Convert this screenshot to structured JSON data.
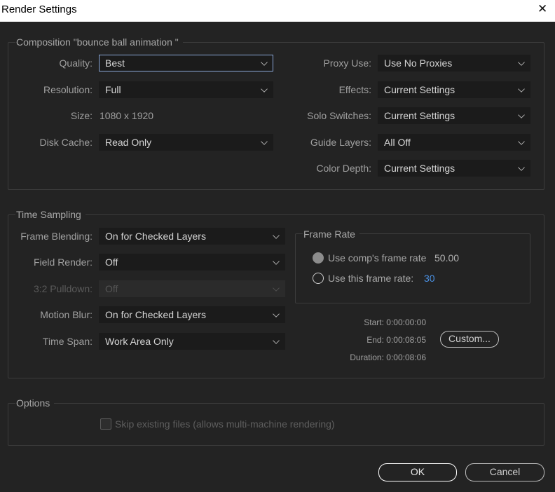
{
  "window": {
    "title": "Render Settings",
    "close_glyph": "✕"
  },
  "composition": {
    "legend": "Composition \"bounce ball animation \"",
    "quality": {
      "label": "Quality:",
      "value": "Best"
    },
    "resolution": {
      "label": "Resolution:",
      "value": "Full"
    },
    "size": {
      "label": "Size:",
      "value": "1080 x 1920"
    },
    "disk_cache": {
      "label": "Disk Cache:",
      "value": "Read Only"
    },
    "proxy_use": {
      "label": "Proxy Use:",
      "value": "Use No Proxies"
    },
    "effects": {
      "label": "Effects:",
      "value": "Current Settings"
    },
    "solo_switches": {
      "label": "Solo Switches:",
      "value": "Current Settings"
    },
    "guide_layers": {
      "label": "Guide Layers:",
      "value": "All Off"
    },
    "color_depth": {
      "label": "Color Depth:",
      "value": "Current Settings"
    }
  },
  "time_sampling": {
    "legend": "Time Sampling",
    "frame_blending": {
      "label": "Frame Blending:",
      "value": "On for Checked Layers"
    },
    "field_render": {
      "label": "Field Render:",
      "value": "Off"
    },
    "pulldown": {
      "label": "3:2 Pulldown:",
      "value": "Off"
    },
    "motion_blur": {
      "label": "Motion Blur:",
      "value": "On for Checked Layers"
    },
    "time_span": {
      "label": "Time Span:",
      "value": "Work Area Only"
    },
    "frame_rate": {
      "legend": "Frame Rate",
      "comp_rate_label": "Use comp's frame rate",
      "comp_rate_value": "50.00",
      "this_rate_label": "Use this frame rate:",
      "this_rate_value": "30"
    },
    "start": "Start: 0:00:00:00",
    "end": "End: 0:00:08:05",
    "duration": "Duration: 0:00:08:06",
    "custom_button": "Custom..."
  },
  "options": {
    "legend": "Options",
    "skip_files_label": "Skip existing files (allows multi-machine rendering)"
  },
  "buttons": {
    "ok": "OK",
    "cancel": "Cancel"
  },
  "colors": {
    "background": "#232323",
    "field": "#1b1b1b",
    "focus": "#8aa7d8",
    "accent_value": "#4a90e2"
  },
  "icons": {
    "dropdown": "chevron-down-icon",
    "close": "close-icon"
  }
}
